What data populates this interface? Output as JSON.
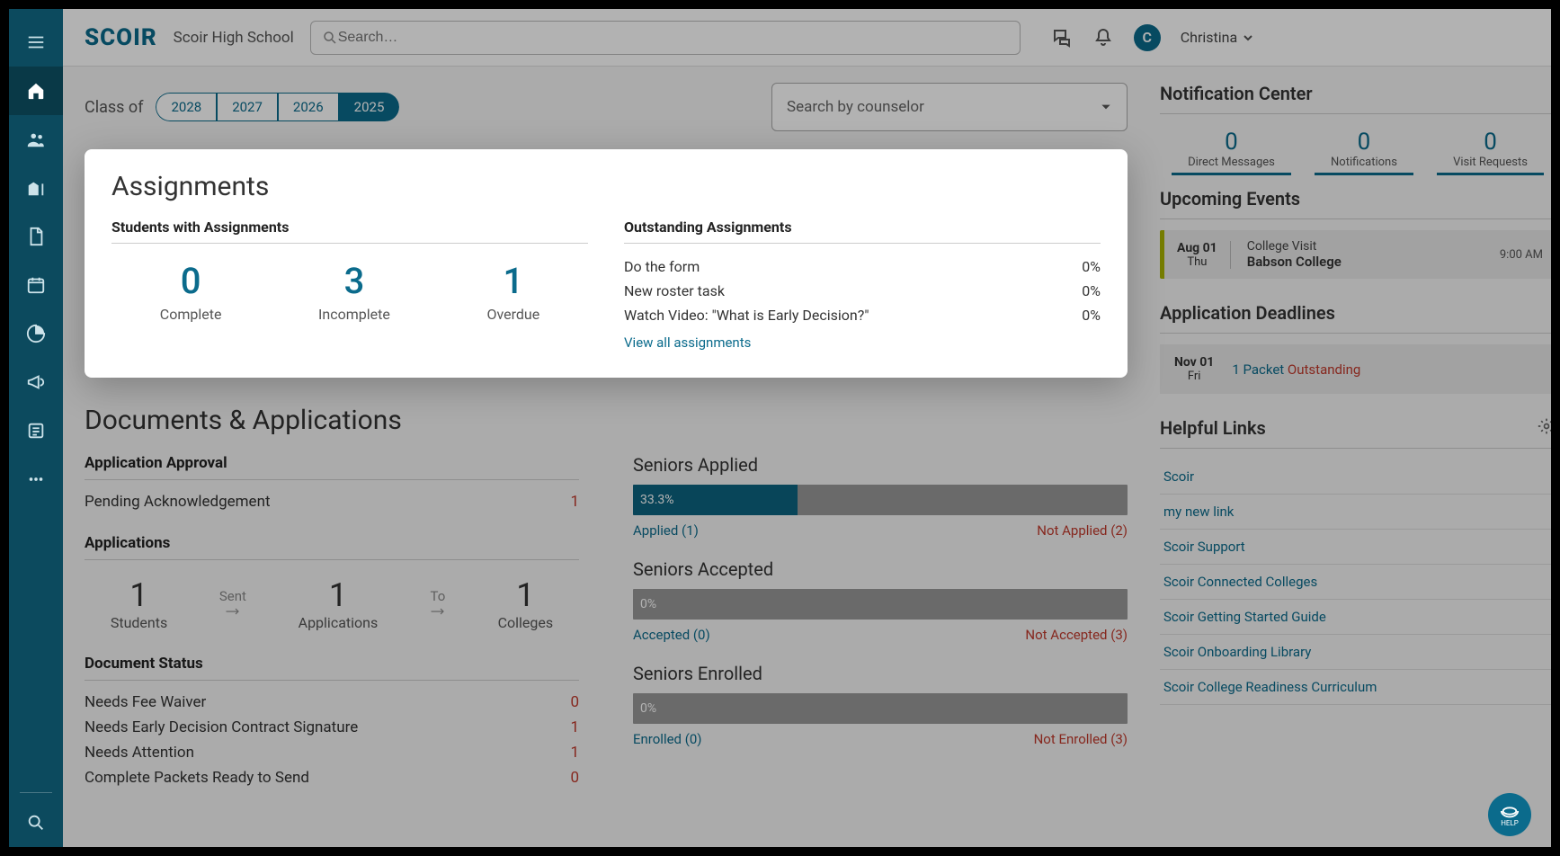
{
  "header": {
    "logo_text": "SCOIR",
    "school": "Scoir High School",
    "search_placeholder": "Search…",
    "avatar_initial": "C",
    "username": "Christina"
  },
  "filters": {
    "class_of_label": "Class of",
    "years": [
      "2028",
      "2027",
      "2026",
      "2025"
    ],
    "active_year": "2025",
    "counselor_placeholder": "Search by counselor"
  },
  "assignments": {
    "title": "Assignments",
    "students_header": "Students with Assignments",
    "outstanding_header": "Outstanding Assignments",
    "stats": [
      {
        "n": "0",
        "label": "Complete"
      },
      {
        "n": "3",
        "label": "Incomplete"
      },
      {
        "n": "1",
        "label": "Overdue"
      }
    ],
    "outstanding": [
      {
        "name": "Do the form",
        "pct": "0%"
      },
      {
        "name": "New roster task",
        "pct": "0%"
      },
      {
        "name": "Watch Video: \"What is Early Decision?\"",
        "pct": "0%"
      }
    ],
    "view_all": "View all assignments"
  },
  "docs": {
    "title": "Documents & Applications",
    "approval_header": "Application Approval",
    "pending_label": "Pending Acknowledgement",
    "pending_value": "1",
    "apps_header": "Applications",
    "app_stats": [
      {
        "n": "1",
        "label": "Students"
      },
      {
        "n": "1",
        "label": "Applications"
      },
      {
        "n": "1",
        "label": "Colleges"
      }
    ],
    "arrow1": "Sent",
    "arrow2": "To",
    "status_header": "Document Status",
    "status_rows": [
      {
        "label": "Needs Fee Waiver",
        "value": "0"
      },
      {
        "label": "Needs Early Decision Contract Signature",
        "value": "1"
      },
      {
        "label": "Needs Attention",
        "value": "1"
      },
      {
        "label": "Complete Packets Ready to Send",
        "value": "0"
      }
    ]
  },
  "seniors": {
    "applied": {
      "label": "Seniors Applied",
      "pct": "33.3%",
      "fill_width": "33.3%",
      "left": "Applied (1)",
      "right": "Not Applied (2)"
    },
    "accepted": {
      "label": "Seniors Accepted",
      "pct": "0%",
      "left": "Accepted (0)",
      "right": "Not Accepted (3)"
    },
    "enrolled": {
      "label": "Seniors Enrolled",
      "pct": "0%",
      "left": "Enrolled (0)",
      "right": "Not Enrolled (3)"
    }
  },
  "side": {
    "notif_title": "Notification Center",
    "notifs": [
      {
        "n": "0",
        "label": "Direct Messages"
      },
      {
        "n": "0",
        "label": "Notifications"
      },
      {
        "n": "0",
        "label": "Visit Requests"
      }
    ],
    "events_title": "Upcoming Events",
    "event": {
      "date": "Aug 01",
      "dow": "Thu",
      "title": "College Visit",
      "sub": "Babson College",
      "time": "9:00 AM"
    },
    "deadlines_title": "Application Deadlines",
    "deadline": {
      "date": "Nov 01",
      "dow": "Fri",
      "packet": "1 Packet",
      "outstanding": "Outstanding"
    },
    "helpful_title": "Helpful Links",
    "links": [
      "Scoir",
      "my new link",
      "Scoir Support",
      "Scoir Connected Colleges",
      "Scoir Getting Started Guide",
      "Scoir Onboarding Library",
      "Scoir College Readiness Curriculum"
    ]
  },
  "helpfab": "HELP"
}
